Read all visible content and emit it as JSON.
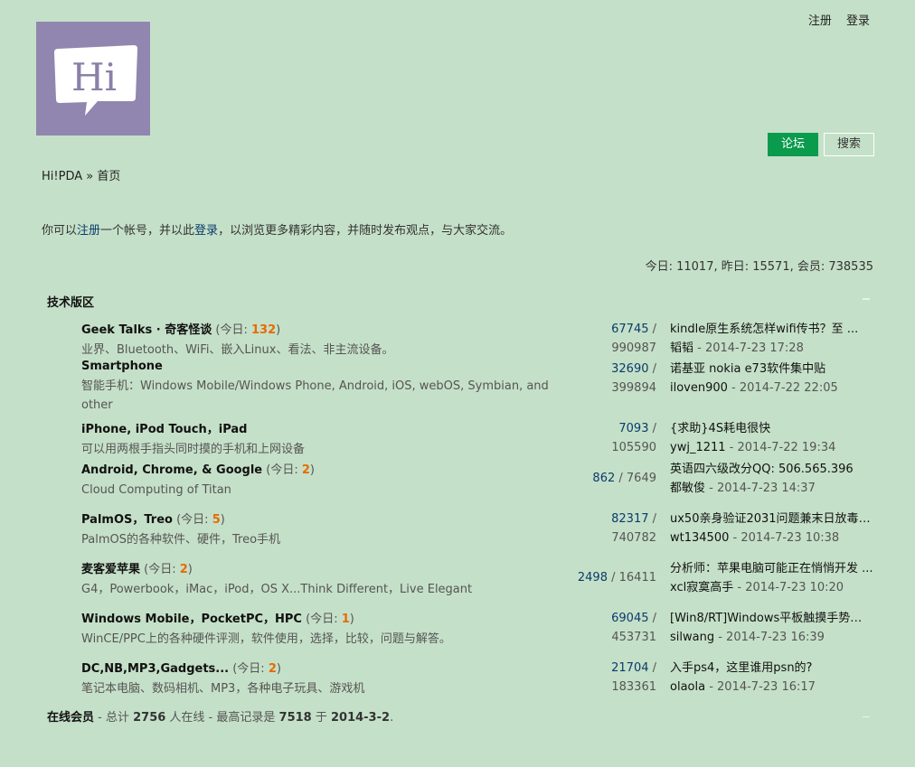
{
  "toplinks": {
    "register": "注册",
    "login": "登录"
  },
  "logo_text": "Hi",
  "tabs": {
    "forum": "论坛",
    "search": "搜索"
  },
  "breadcrumb": {
    "site": "Hi!PDA",
    "sep": "»",
    "page": "首页"
  },
  "notice": {
    "pre": "你可以",
    "register": "注册",
    "mid": "一个帐号，并以此",
    "login": "登录",
    "post": "，以浏览更多精彩内容，并随时发布观点，与大家交流。"
  },
  "stats": "今日: 11017, 昨日: 15571, 会员: 738535",
  "section": {
    "title": "技术版区"
  },
  "forums": [
    {
      "name": "Geek Talks · 奇客怪谈",
      "today_label": "(今日: ",
      "today": "132",
      "today_end": ")",
      "desc": "业界、Bluetooth、WiFi、嵌入Linux、看法、非主流设备。",
      "topics": "67745",
      "sep": " /",
      "posts": "990987",
      "last_title": "kindle原生系统怎样wifi传书？至 ...",
      "last_author": "韬韬",
      "last_time": " - 2014-7-23 17:28"
    },
    {
      "name": "Smartphone",
      "today_label": "",
      "today": "",
      "today_end": "",
      "desc": "智能手机：Windows Mobile/Windows Phone, Android, iOS, webOS, Symbian, and other",
      "topics": "32690",
      "sep": " /",
      "posts": "399894",
      "last_title": "诺基亚 nokia e73软件集中贴",
      "last_author": "iloven900",
      "last_time": " - 2014-7-22 22:05"
    },
    {
      "name": "iPhone, iPod Touch，iPad",
      "today_label": "",
      "today": "",
      "today_end": "",
      "desc": "可以用两根手指头同时摸的手机和上网设备",
      "topics": "7093",
      "sep": " /",
      "posts": "105590",
      "last_title": "{求助}4S耗电很快",
      "last_author": "ywj_1211",
      "last_time": " - 2014-7-22 19:34"
    },
    {
      "name": "Android, Chrome, & Google",
      "today_label": "(今日: ",
      "today": "2",
      "today_end": ")",
      "desc": "Cloud Computing of Titan",
      "topics": "862",
      "sep": " / ",
      "posts": "7649",
      "last_title": "英语四六级改分QQ: 506.565.396",
      "last_author": "都敏俊",
      "last_time": " - 2014-7-23 14:37"
    },
    {
      "name": "PalmOS，Treo",
      "today_label": "(今日: ",
      "today": "5",
      "today_end": ")",
      "desc": "PalmOS的各种软件、硬件，Treo手机",
      "topics": "82317",
      "sep": " /",
      "posts": "740782",
      "last_title": "ux50亲身验证2031问题兼末日放毒 ...",
      "last_author": "wt134500",
      "last_time": " - 2014-7-23 10:38"
    },
    {
      "name": "麦客爱苹果",
      "today_label": "(今日: ",
      "today": "2",
      "today_end": ")",
      "desc": "G4，Powerbook，iMac，iPod，OS X...Think Different，Live Elegant",
      "topics": "2498",
      "sep": " / ",
      "posts": "16411",
      "last_title": "分析师：苹果电脑可能正在悄悄开发 ...",
      "last_author": "xcl寂寞高手",
      "last_time": " - 2014-7-23 10:20"
    },
    {
      "name": "Windows Mobile，PocketPC，HPC",
      "today_label": "(今日: ",
      "today": "1",
      "today_end": ")",
      "desc": "WinCE/PPC上的各种硬件评测，软件使用，选择，比较，问题与解答。",
      "topics": "69045",
      "sep": " /",
      "posts": "453731",
      "last_title": "[Win8/RT]Windows平板触摸手势和 ...",
      "last_author": "silwang",
      "last_time": " - 2014-7-23 16:39"
    },
    {
      "name": "DC,NB,MP3,Gadgets...",
      "today_label": "(今日: ",
      "today": "2",
      "today_end": ")",
      "desc": "笔记本电脑、数码相机、MP3，各种电子玩具、游戏机",
      "topics": "21704",
      "sep": " /",
      "posts": "183361",
      "last_title": "入手ps4，这里谁用psn的?",
      "last_author": "olaola",
      "last_time": " - 2014-7-23 16:17"
    }
  ],
  "online": {
    "label": "在线会员",
    "t1": " - 总计 ",
    "total": "2756",
    "t2": " 人在线 - 最高记录是 ",
    "record": "7518",
    "t3": " 于 ",
    "date": "2014-3-2",
    "t4": "."
  },
  "colors": {
    "background": "#c5e0c8",
    "tab_active": "#0a9b4d",
    "logo_bg": "#9186b0",
    "highlight": "#e76b00"
  }
}
